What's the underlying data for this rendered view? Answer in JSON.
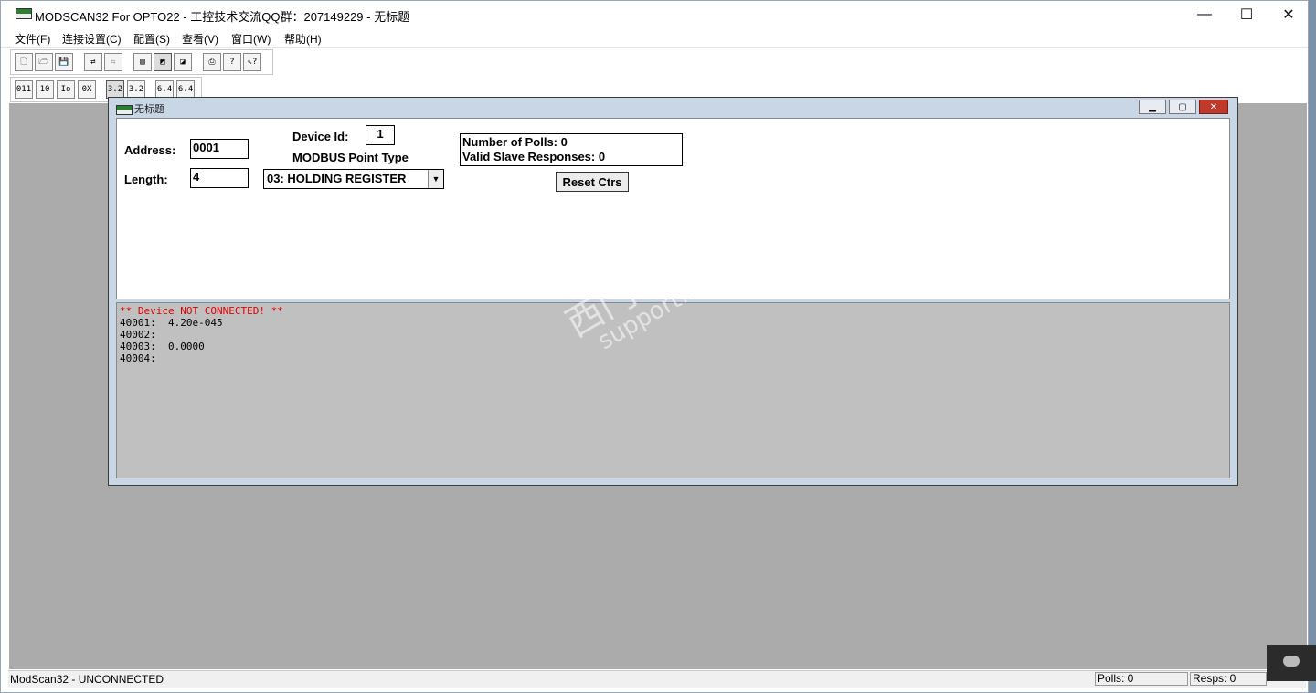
{
  "window": {
    "title": "MODSCAN32 For OPTO22 - 工控技术交流QQ群：207149229 - 无标题",
    "minimize": "—",
    "maximize": "☐",
    "close": "✕"
  },
  "menu": [
    "文件(F)",
    "连接设置(C)",
    "配置(S)",
    "查看(V)",
    "窗口(W)",
    "帮助(H)"
  ],
  "toolbar1": [
    {
      "icon": "new-file-icon",
      "glyph": "🗋"
    },
    {
      "icon": "open-folder-icon",
      "glyph": "🗁"
    },
    {
      "icon": "save-icon",
      "glyph": "💾"
    },
    {
      "icon": "connect-icon",
      "glyph": "⇄"
    },
    {
      "icon": "disconnect-icon",
      "glyph": "⇆"
    },
    {
      "icon": "display-text-icon",
      "glyph": "▤"
    },
    {
      "icon": "display-graph-icon",
      "glyph": "◩"
    },
    {
      "icon": "display-data-icon",
      "glyph": "◪"
    },
    {
      "icon": "print-icon",
      "glyph": "⎙"
    },
    {
      "icon": "help-icon",
      "glyph": "?"
    },
    {
      "icon": "context-help-icon",
      "glyph": "↖?"
    }
  ],
  "toolbar2": [
    {
      "icon": "format-binary-icon",
      "glyph": "011"
    },
    {
      "icon": "format-decimal-icon",
      "glyph": "10"
    },
    {
      "icon": "format-integer-icon",
      "glyph": "Io"
    },
    {
      "icon": "format-hex-icon",
      "glyph": "0X"
    },
    {
      "icon": "format-float-icon",
      "glyph": "3.2"
    },
    {
      "icon": "format-float-swapped-icon",
      "glyph": "3.2"
    },
    {
      "icon": "format-double-icon",
      "glyph": "6.4"
    },
    {
      "icon": "format-double-swapped-icon",
      "glyph": "6.4"
    }
  ],
  "child": {
    "title": "无标题",
    "minimize": "▁",
    "maximize": "▢",
    "close": "✕"
  },
  "form": {
    "address_label": "Address:",
    "address_value": "0001",
    "length_label": "Length:",
    "length_value": "4",
    "device_id_label": "Device Id:",
    "device_id_value": "1",
    "point_type_label": "MODBUS Point Type",
    "point_type_value": "03: HOLDING REGISTER",
    "select_arrow": "▼",
    "polls": "Number of Polls: 0",
    "responses": "Valid Slave Responses: 0",
    "reset_button": "Reset Ctrs"
  },
  "data": {
    "error": "** Device NOT CONNECTED! **",
    "rows": [
      "40001:  4.20e-045",
      "40002:",
      "40003:  0.0000",
      "40004:"
    ]
  },
  "watermark": {
    "line1": "西门子工业  技术论坛",
    "line2": "support.industry.siemens.com/cs"
  },
  "status": {
    "text": "ModScan32 - UNCONNECTED",
    "polls": "Polls: 0",
    "resps": "Resps: 0"
  }
}
